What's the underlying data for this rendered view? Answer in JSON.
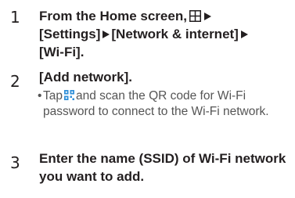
{
  "steps": [
    {
      "number": "1",
      "prefix": "From the Home screen,",
      "items": [
        "[Settings]",
        "[Network & internet]",
        "[Wi-Fi]."
      ]
    },
    {
      "number": "2",
      "text": "[Add network].",
      "note": {
        "bullet": "•",
        "before": "Tap",
        "after": "and scan the QR code for Wi-Fi password to connect to the Wi-Fi network."
      }
    },
    {
      "number": "3",
      "text": "Enter the name (SSID) of Wi-Fi network you want to add."
    }
  ],
  "icons": {
    "apps": "apps-grid-icon",
    "arrow": "triangle-right-icon",
    "qr": "qr-scan-icon"
  },
  "colors": {
    "text": "#231f20",
    "note_text": "#555555",
    "qr_icon": "#2f8fd8"
  }
}
